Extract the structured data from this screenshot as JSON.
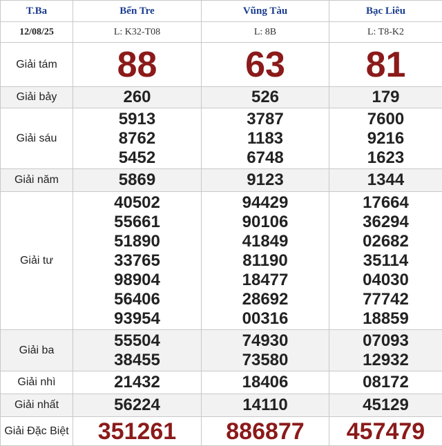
{
  "header": {
    "weekday": "T.Ba",
    "date": "12/08/25",
    "provinces": [
      "Bến Tre",
      "Vũng Tàu",
      "Bạc Liêu"
    ],
    "ticket_codes": [
      "L: K32-T08",
      "L: 8B",
      "L: T8-K2"
    ]
  },
  "prizes": {
    "tam": {
      "label": "Giải tám",
      "values": [
        [
          "88"
        ],
        [
          "63"
        ],
        [
          "81"
        ]
      ]
    },
    "bay": {
      "label": "Giải bảy",
      "values": [
        [
          "260"
        ],
        [
          "526"
        ],
        [
          "179"
        ]
      ]
    },
    "sau": {
      "label": "Giải sáu",
      "values": [
        [
          "5913",
          "8762",
          "5452"
        ],
        [
          "3787",
          "1183",
          "6748"
        ],
        [
          "7600",
          "9216",
          "1623"
        ]
      ]
    },
    "nam": {
      "label": "Giải năm",
      "values": [
        [
          "5869"
        ],
        [
          "9123"
        ],
        [
          "1344"
        ]
      ]
    },
    "tu": {
      "label": "Giải tư",
      "values": [
        [
          "40502",
          "55661",
          "51890",
          "33765",
          "98904",
          "56406",
          "93954"
        ],
        [
          "94429",
          "90106",
          "41849",
          "81190",
          "18477",
          "28692",
          "00316"
        ],
        [
          "17664",
          "36294",
          "02682",
          "35114",
          "04030",
          "77742",
          "18859"
        ]
      ]
    },
    "ba": {
      "label": "Giải ba",
      "values": [
        [
          "55504",
          "38455"
        ],
        [
          "74930",
          "73580"
        ],
        [
          "07093",
          "12932"
        ]
      ]
    },
    "nhi": {
      "label": "Giải nhì",
      "values": [
        [
          "21432"
        ],
        [
          "18406"
        ],
        [
          "08172"
        ]
      ]
    },
    "nhat": {
      "label": "Giải nhất",
      "values": [
        [
          "56224"
        ],
        [
          "14110"
        ],
        [
          "45129"
        ]
      ]
    },
    "dacbiet": {
      "label": "Giải Đặc Biệt",
      "values": [
        [
          "351261"
        ],
        [
          "886877"
        ],
        [
          "457479"
        ]
      ]
    }
  },
  "colors": {
    "header_text": "#1a3d8f",
    "highlight_number": "#8b1a1a",
    "alt_row": "#f2f2f2"
  }
}
